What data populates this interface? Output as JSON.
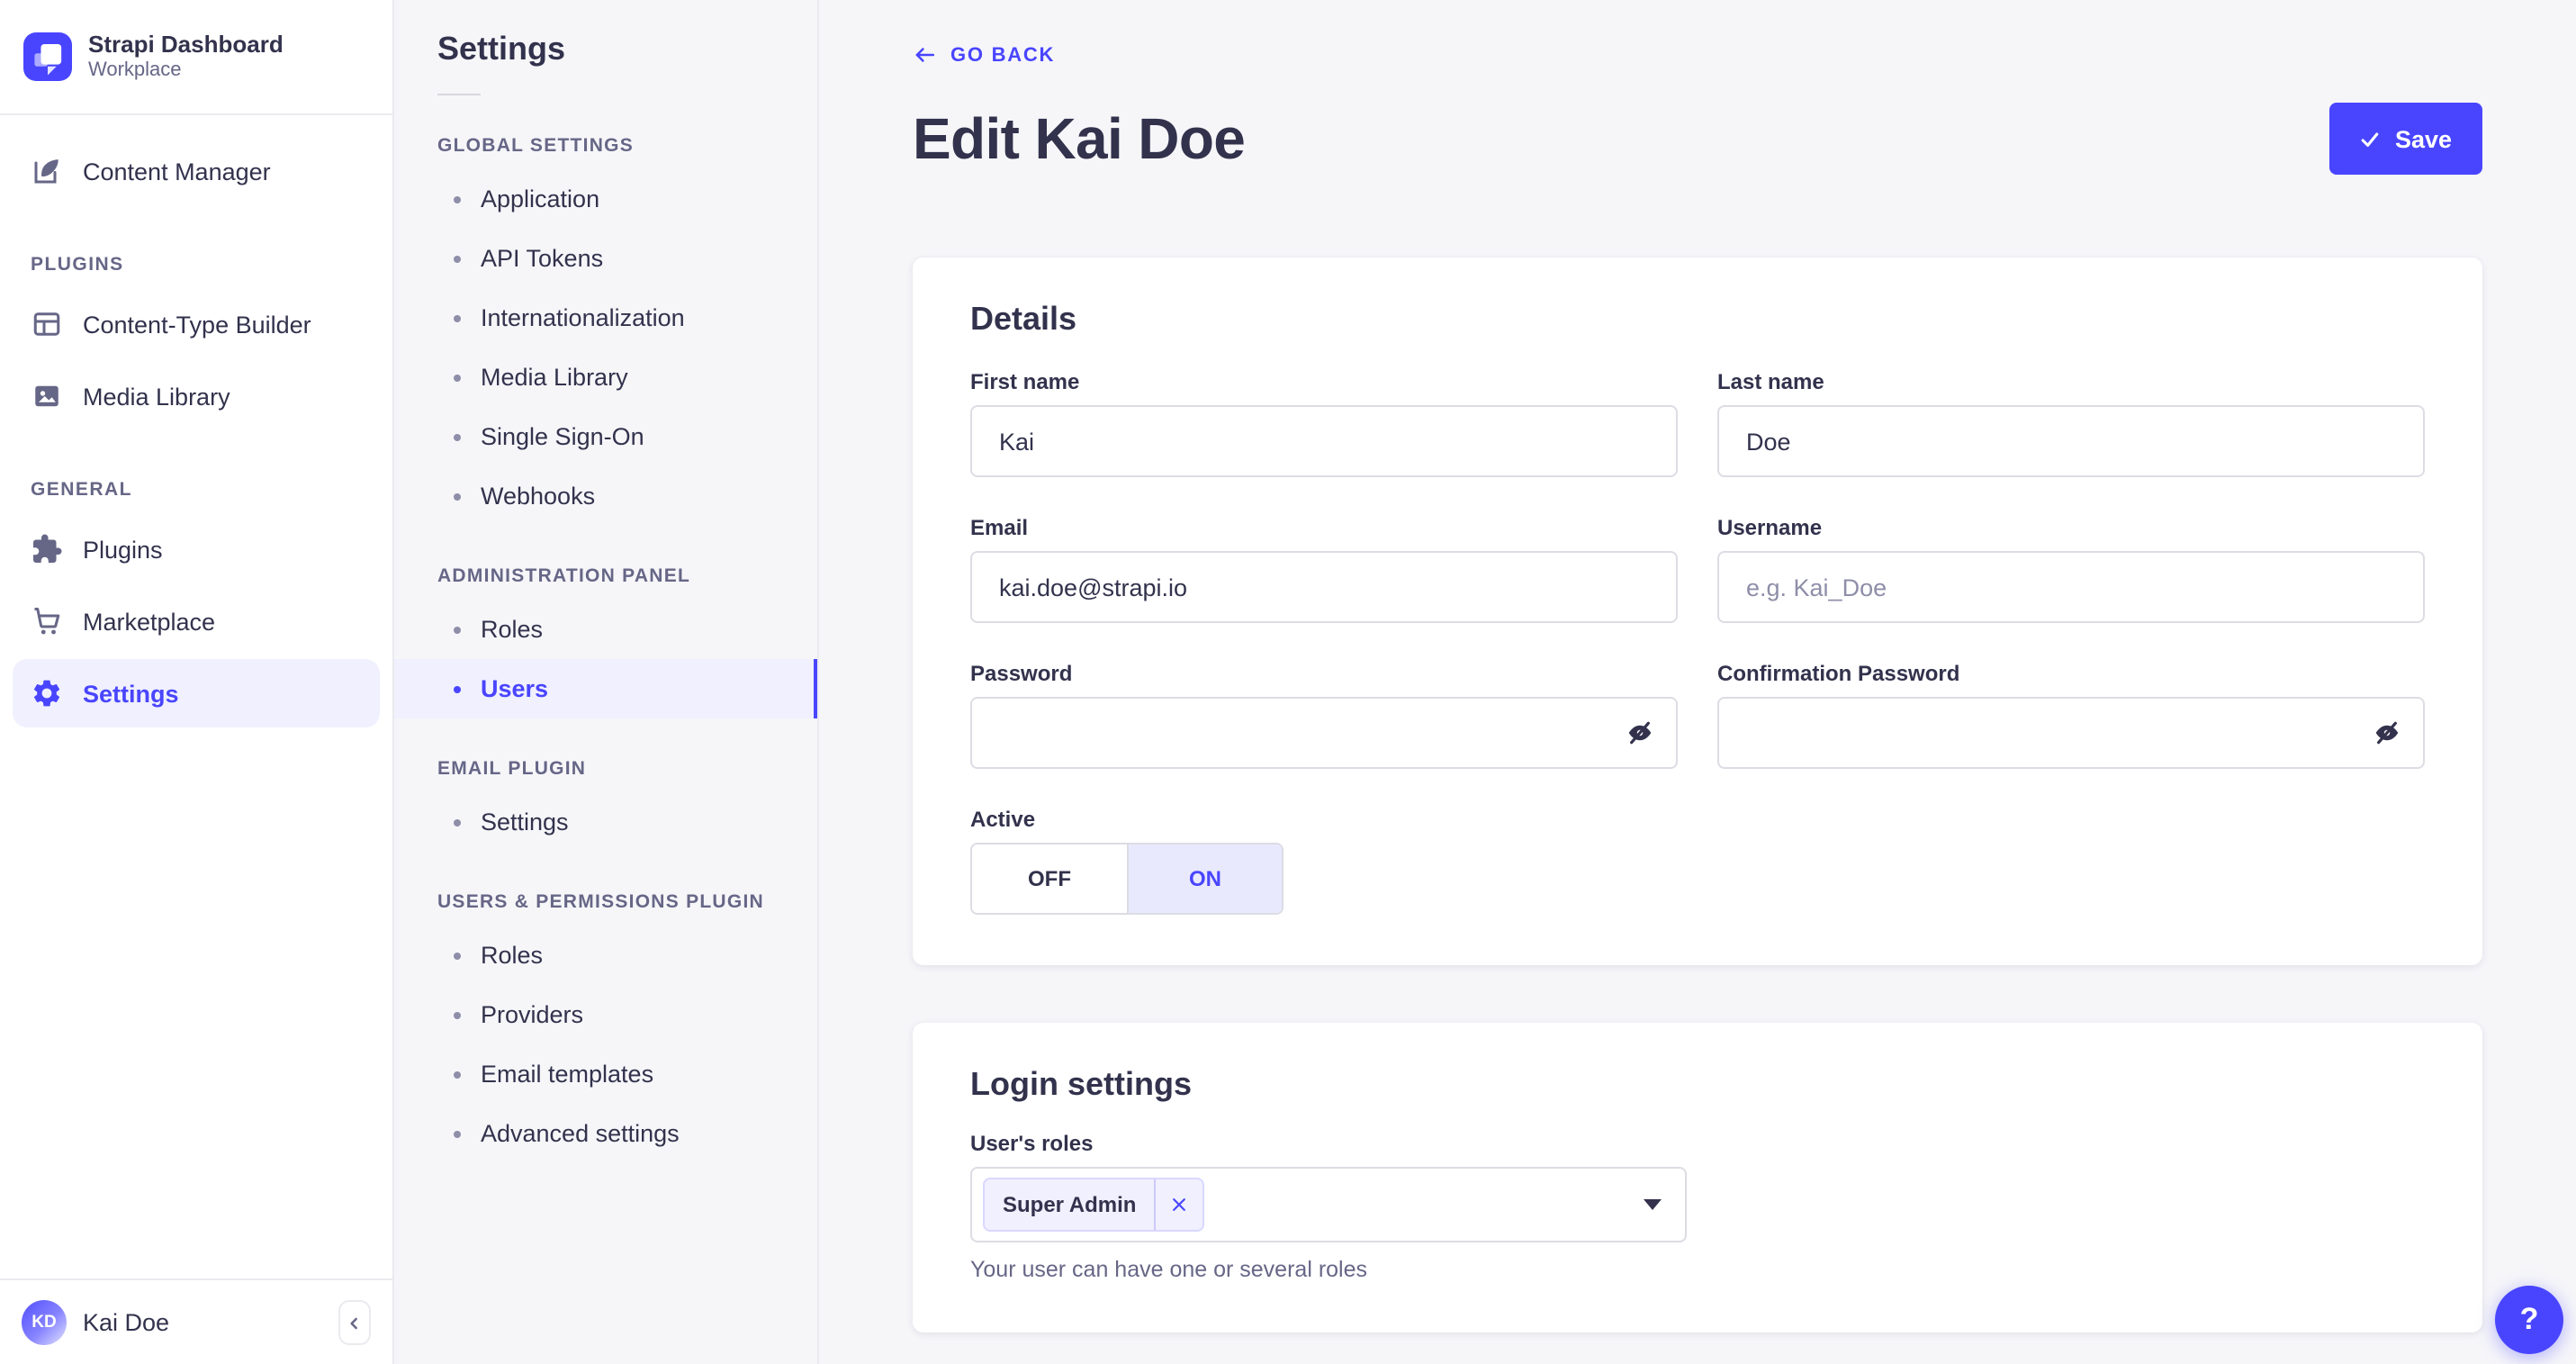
{
  "brand": {
    "title": "Strapi Dashboard",
    "subtitle": "Workplace"
  },
  "sidebar": {
    "items_top": [
      {
        "label": "Content Manager"
      }
    ],
    "sections": [
      {
        "header": "PLUGINS",
        "items": [
          {
            "label": "Content-Type Builder"
          },
          {
            "label": "Media Library"
          }
        ]
      },
      {
        "header": "GENERAL",
        "items": [
          {
            "label": "Plugins"
          },
          {
            "label": "Marketplace"
          },
          {
            "label": "Settings"
          }
        ]
      }
    ],
    "user": {
      "initials": "KD",
      "name": "Kai Doe"
    }
  },
  "subnav": {
    "title": "Settings",
    "sections": [
      {
        "header": "GLOBAL SETTINGS",
        "items": [
          "Application",
          "API Tokens",
          "Internationalization",
          "Media Library",
          "Single Sign-On",
          "Webhooks"
        ]
      },
      {
        "header": "ADMINISTRATION PANEL",
        "items": [
          "Roles",
          "Users"
        ]
      },
      {
        "header": "EMAIL PLUGIN",
        "items": [
          "Settings"
        ]
      },
      {
        "header": "USERS & PERMISSIONS PLUGIN",
        "items": [
          "Roles",
          "Providers",
          "Email templates",
          "Advanced settings"
        ]
      }
    ],
    "active_item": "Users"
  },
  "header": {
    "back_label": "GO BACK",
    "title": "Edit Kai Doe",
    "save_label": "Save"
  },
  "details_card": {
    "title": "Details",
    "fields": {
      "first_name": {
        "label": "First name",
        "value": "Kai"
      },
      "last_name": {
        "label": "Last name",
        "value": "Doe"
      },
      "email": {
        "label": "Email",
        "value": "kai.doe@strapi.io"
      },
      "username": {
        "label": "Username",
        "placeholder": "e.g. Kai_Doe"
      },
      "password": {
        "label": "Password",
        "value": ""
      },
      "confirm_password": {
        "label": "Confirmation Password",
        "value": ""
      },
      "active": {
        "label": "Active",
        "off": "OFF",
        "on": "ON",
        "value": "ON"
      }
    }
  },
  "login_card": {
    "title": "Login settings",
    "roles_label": "User's roles",
    "selected_roles": [
      {
        "name": "Super Admin"
      }
    ],
    "helper": "Your user can have one or several roles"
  },
  "help_label": "?",
  "colors": {
    "primary": "#4945ff",
    "primary_bg": "#f0f0ff",
    "text": "#32324d",
    "muted": "#666687",
    "border": "#eaeaef",
    "input_border": "#dcdce4",
    "content_bg": "#f6f6f9"
  }
}
